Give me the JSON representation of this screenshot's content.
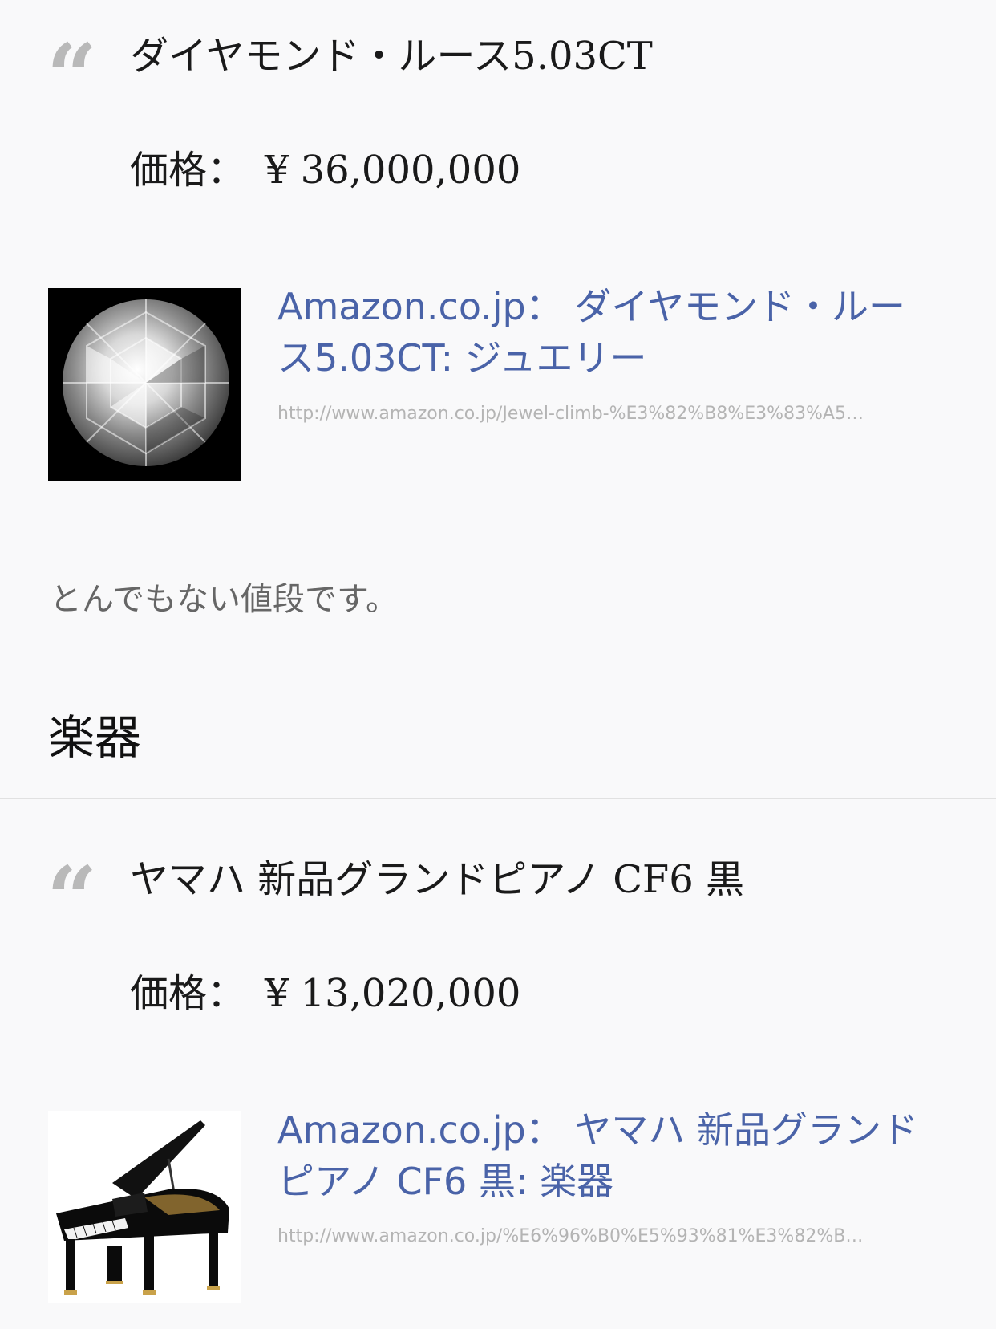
{
  "quote1": {
    "mark": "“",
    "title": "ダイヤモンド・ルース5.03CT",
    "price_label": "価格：",
    "price_currency": "¥",
    "price_value": "36,000,000",
    "link_title": "Amazon.co.jp： ダイヤモンド・ルース5.03CT: ジュエリー",
    "link_url": "http://www.amazon.co.jp/Jewel-climb-%E3%82%B8%E3%83%A5…",
    "thumb_icon": "diamond-image"
  },
  "comment": "とんでもない値段です。",
  "section_heading": "楽器",
  "quote2": {
    "mark": "“",
    "title": "ヤマハ 新品グランドピアノ CF6 黒",
    "price_label": "価格：",
    "price_currency": "¥",
    "price_value": "13,020,000",
    "link_title": "Amazon.co.jp： ヤマハ 新品グランドピアノ CF6 黒: 楽器",
    "link_url": "http://www.amazon.co.jp/%E6%96%B0%E5%93%81%E3%82%B…",
    "thumb_icon": "grand-piano-image"
  },
  "colors": {
    "background": "#f9f9fa",
    "link": "#4a63a8",
    "quote_mark": "#b9b9b9",
    "url": "#b4b4b4",
    "divider": "#e1e1e1"
  }
}
